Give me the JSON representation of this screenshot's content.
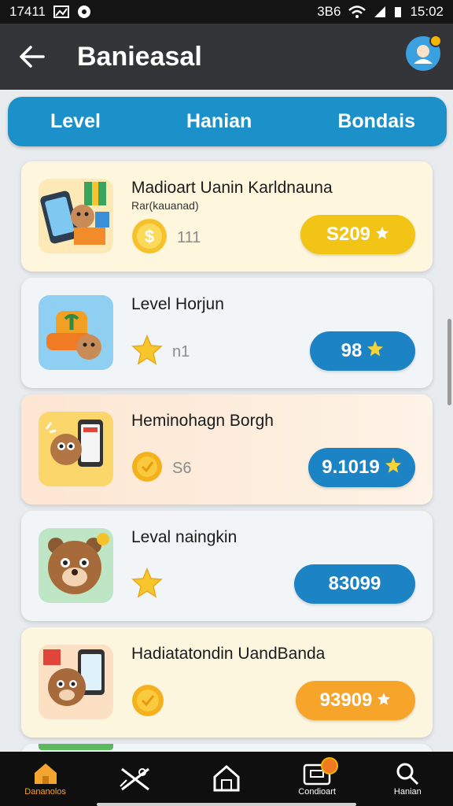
{
  "status_bar": {
    "time": "17411",
    "right_text": "3B6",
    "clock": "15:02"
  },
  "header": {
    "title": "Banieasal"
  },
  "tabs": [
    {
      "label": "Level"
    },
    {
      "label": "Hanian"
    },
    {
      "label": "Bondais"
    }
  ],
  "items": [
    {
      "title": "Madioart Uanin Karldnauna",
      "subtitle": "Rar(kauanad)",
      "meta_icon": "coin-icon",
      "meta_value": "111",
      "price": "S209",
      "price_icon": "star-icon",
      "price_color": "#f2c415",
      "thumb_icon": "phone-gift-icon"
    },
    {
      "title": "Level Horjun",
      "subtitle": "",
      "meta_icon": "star-icon",
      "meta_value": "n1",
      "price": "98",
      "price_icon": "star-icon",
      "price_color": "#1c83c4",
      "thumb_icon": "backpack-icon"
    },
    {
      "title": "Heminohagn Borgh",
      "subtitle": "",
      "meta_icon": "coin-icon",
      "meta_value": "S6",
      "price": "9.1019",
      "price_icon": "star-icon",
      "price_color": "#1c83c4",
      "thumb_icon": "otter-phone-icon"
    },
    {
      "title": "Leval naingkin",
      "subtitle": "",
      "meta_icon": "star-icon",
      "meta_value": "",
      "price": "83099",
      "price_icon": "",
      "price_color": "#1c83c4",
      "thumb_icon": "bear-icon"
    },
    {
      "title": "Hadiatatondin UandBanda",
      "subtitle": "",
      "meta_icon": "coin-icon",
      "meta_value": "",
      "price": "93909",
      "price_icon": "star-icon",
      "price_color": "#f7a52a",
      "thumb_icon": "bear-tablet-icon"
    }
  ],
  "bottom_nav": [
    {
      "label": "Dananolos",
      "icon": "home-icon",
      "active": true
    },
    {
      "label": "",
      "icon": "tools-icon",
      "active": false
    },
    {
      "label": "",
      "icon": "house-outline-icon",
      "active": false
    },
    {
      "label": "Condioart",
      "icon": "wallet-icon",
      "active": false
    },
    {
      "label": "Hanian",
      "icon": "search-icon",
      "active": false
    }
  ]
}
